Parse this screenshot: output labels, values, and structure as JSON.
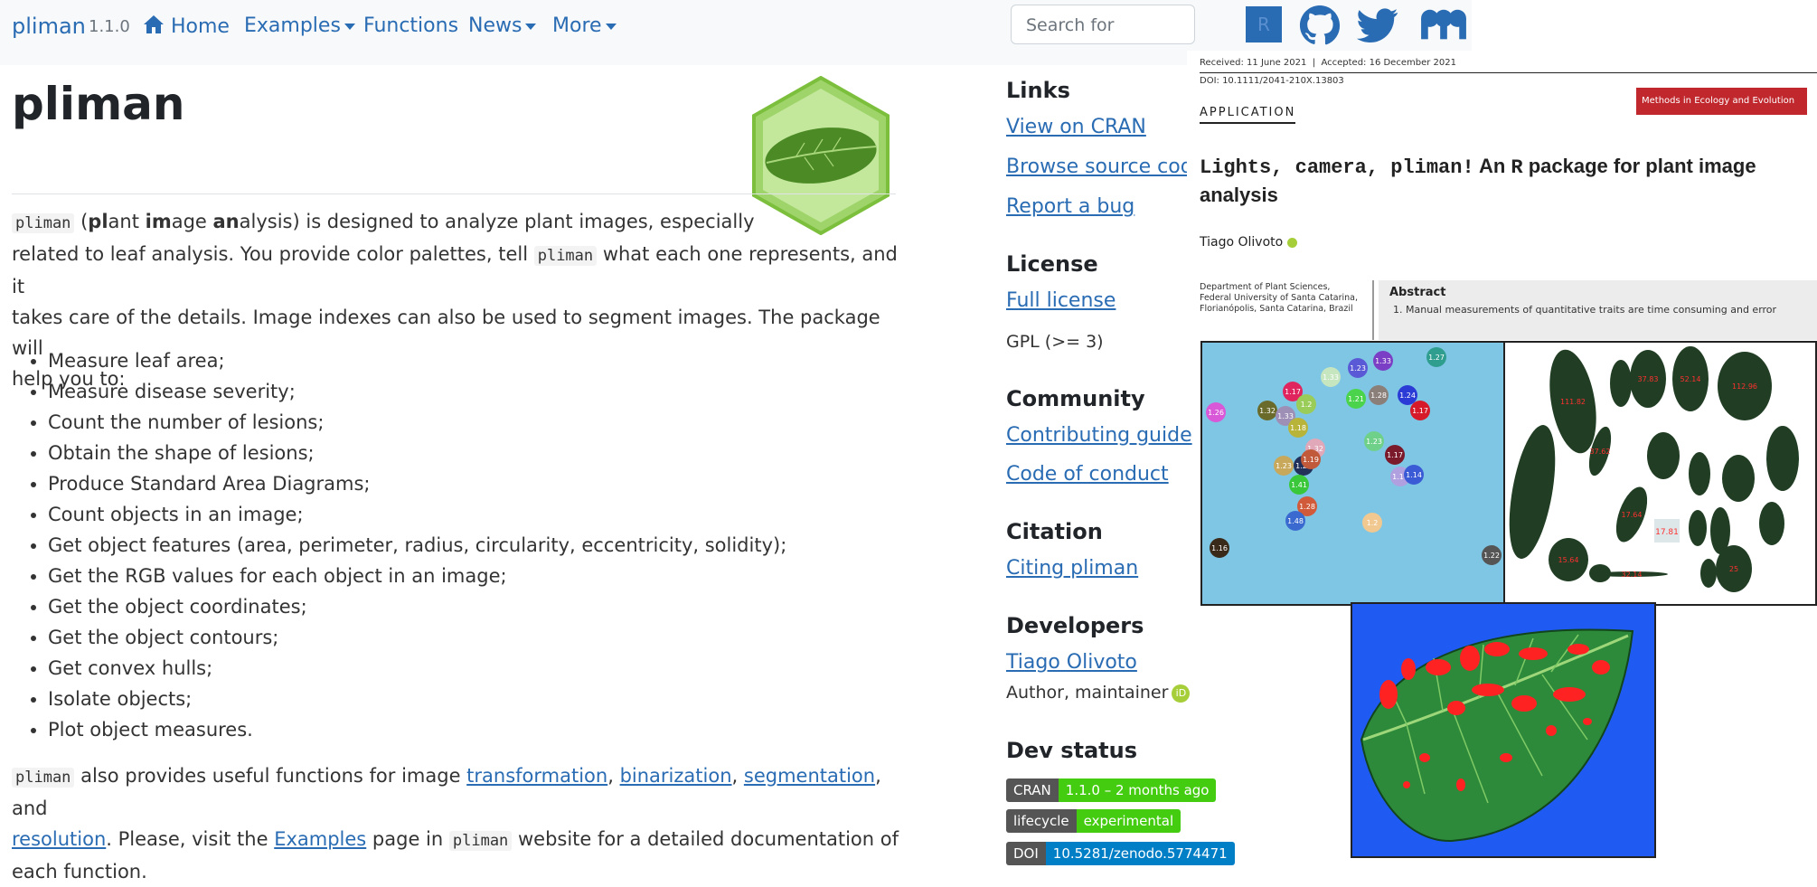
{
  "navbar": {
    "brand": "pliman",
    "version": "1.1.0",
    "items": [
      {
        "label": "Home"
      },
      {
        "label": "Examples"
      },
      {
        "label": "Functions"
      },
      {
        "label": "News"
      },
      {
        "label": "More"
      }
    ],
    "search_placeholder": "Search for",
    "icons": [
      "r-icon",
      "github-icon",
      "twitter-icon",
      "mastodon-icon"
    ]
  },
  "main": {
    "title": "pliman",
    "intro": {
      "code": "pliman",
      "t1": " (",
      "b1": "pl",
      "t2": "ant ",
      "b2": "im",
      "t3": "age ",
      "b3": "an",
      "t4": "alysis) is designed to analyze plant images, especially",
      "line2a": "related to leaf analysis. You provide color palettes, tell ",
      "code2": "pliman",
      "line2b": " what each one represents, and it",
      "line3": "takes care of the details. Image indexes can also be used to segment images. The package will",
      "line4": "help you to:"
    },
    "features": [
      "Measure leaf area;",
      "Measure disease severity;",
      "Count the number of lesions;",
      "Obtain the shape of lesions;",
      "Produce Standard Area Diagrams;",
      "Count objects in an image;",
      "Get object features (area, perimeter, radius, circularity, eccentricity, solidity);",
      "Get the RGB values for each object in an image;",
      "Get the object coordinates;",
      "Get the object contours;",
      "Get convex hulls;",
      "Isolate objects;",
      "Plot object measures."
    ],
    "outro": {
      "code": "pliman",
      "t1": " also provides useful functions for image ",
      "l1": "transformation",
      "s1": ", ",
      "l2": "binarization",
      "s2": ", ",
      "l3": "segmentation",
      "t2": ", and",
      "l4": "resolution",
      "t3": ". Please, visit the ",
      "l5": "Examples",
      "t4": " page in ",
      "code2": "pliman",
      "t5": " website for a detailed documentation of",
      "t6": "each function."
    }
  },
  "sidebar": {
    "links_h": "Links",
    "links": [
      "View on CRAN",
      "Browse source code",
      "Report a bug"
    ],
    "license_h": "License",
    "license_link": "Full license",
    "license_text": "GPL (>= 3)",
    "community_h": "Community",
    "community": [
      "Contributing guide",
      "Code of conduct"
    ],
    "citation_h": "Citation",
    "citation_link": "Citing pliman",
    "developers_h": "Developers",
    "developer": "Tiago Olivoto",
    "developer_role": "Author, maintainer",
    "devstatus_h": "Dev status",
    "badges": [
      {
        "l": "CRAN",
        "r": "1.1.0 – 2 months ago",
        "color": "#4c1"
      },
      {
        "l": "lifecycle",
        "r": "experimental",
        "color": "#4c1"
      },
      {
        "l": "DOI",
        "r": "10.5281/zenodo.5774471",
        "color": "#007ec6"
      }
    ]
  },
  "paper": {
    "received": "Received: 11 June 2021",
    "accepted": "Accepted: 16 December 2021",
    "doi": "DOI: 10.1111/2041-210X.13803",
    "section": "APPLICATION",
    "journal": "Methods in Ecology and Evolution",
    "title_a": "Lights, camera, pliman!",
    "title_b": " An ",
    "title_c": "R",
    "title_d": " package for plant image analysis",
    "author": "Tiago Olivoto",
    "aff1": "Department of Plant Sciences,",
    "aff2": "Federal University of Santa Catarina,",
    "aff3": "Florianópolis, Santa Catarina, Brazil",
    "abstract_h": "Abstract",
    "abstract_t": "1.  Manual measurements of quantitative traits are time consuming and error"
  },
  "figures": {
    "seeds": [
      "1.27",
      "1.33",
      "1.23",
      "1.33",
      "1.17",
      "1.28",
      "1.24",
      "1.26",
      "1.2",
      "1.21",
      "1.17",
      "1.32",
      "1.33",
      "1.18",
      "1.23",
      "1.32",
      "1.23",
      "1.23",
      "1.19",
      "1.17",
      "1.16",
      "1.14",
      "1.41",
      "1.28",
      "1.48",
      "1.2",
      "1.16",
      "1.22"
    ],
    "leaves": [
      "111.82",
      "37.83",
      "52.14",
      "112.96",
      "37.62",
      "17.64",
      "15.64",
      "25",
      "32.14",
      "17.81"
    ],
    "colors": {
      "accent": "#2a6cb3",
      "orcid": "#a6ce39",
      "journal": "#c0282d"
    }
  }
}
